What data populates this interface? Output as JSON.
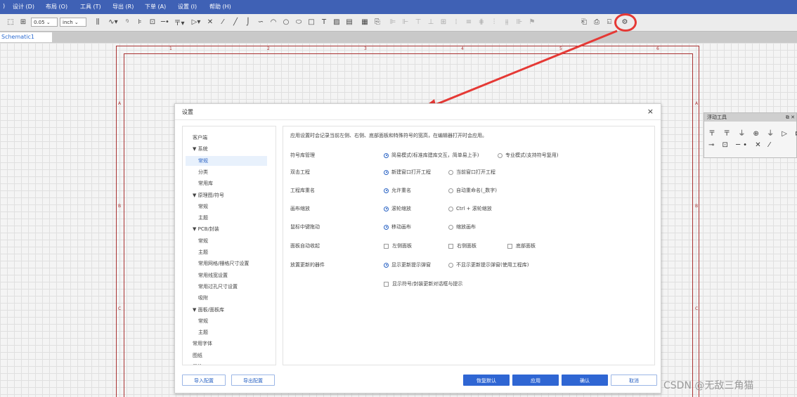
{
  "menu": [
    "设计 (D)",
    "布局 (O)",
    "工具 (T)",
    "导出 (R)",
    "下单 (A)",
    "设置 (I)",
    "帮助 (H)"
  ],
  "toolbar": {
    "grid_value": "0.05",
    "unit": "inch"
  },
  "tab": "Schematic1",
  "sheet": {
    "col_labels": [
      "1",
      "2",
      "3",
      "4",
      "5",
      "6"
    ],
    "row_labels": [
      "A",
      "B",
      "C"
    ]
  },
  "float_panel": {
    "title": "浮动工具",
    "row1": "〒 〒 ⏚ ⊕ ⏚ ▷ ⊳",
    "row2": "⊸ ⊡ ─• ✕ ⁄"
  },
  "dialog": {
    "title": "设置",
    "close": "×",
    "tree": [
      {
        "label": "客户端",
        "level": 0,
        "selected": false
      },
      {
        "label": "▼ 系统",
        "level": 0,
        "selected": false
      },
      {
        "label": "常规",
        "level": 1,
        "selected": true
      },
      {
        "label": "分类",
        "level": 1,
        "selected": false
      },
      {
        "label": "常用库",
        "level": 1,
        "selected": false
      },
      {
        "label": "▼ 原理图/符号",
        "level": 0,
        "selected": false
      },
      {
        "label": "常规",
        "level": 1,
        "selected": false
      },
      {
        "label": "主题",
        "level": 1,
        "selected": false
      },
      {
        "label": "▼ PCB/封装",
        "level": 0,
        "selected": false
      },
      {
        "label": "常规",
        "level": 1,
        "selected": false
      },
      {
        "label": "主题",
        "level": 1,
        "selected": false
      },
      {
        "label": "常用网格/栅格尺寸设置",
        "level": 1,
        "selected": false
      },
      {
        "label": "常用线宽设置",
        "level": 1,
        "selected": false
      },
      {
        "label": "常用过孔尺寸设置",
        "level": 1,
        "selected": false
      },
      {
        "label": "吸附",
        "level": 1,
        "selected": false
      },
      {
        "label": "▼ 面板/面板库",
        "level": 0,
        "selected": false
      },
      {
        "label": "常规",
        "level": 1,
        "selected": false
      },
      {
        "label": "主题",
        "level": 1,
        "selected": false
      },
      {
        "label": "常用字体",
        "level": 0,
        "selected": false
      },
      {
        "label": "图纸",
        "level": 0,
        "selected": false
      },
      {
        "label": "属性",
        "level": 0,
        "selected": false
      }
    ],
    "description": "应用设置时会记录当前左侧、右侧、底部面板和特殊符号的宽高，在编辑器打开时会应用。",
    "rows": [
      {
        "label": "符号库管理",
        "options": [
          {
            "type": "radio",
            "checked": true,
            "text": "简易模式(标准库建库交互，简单易上手)"
          },
          {
            "type": "radio",
            "checked": false,
            "text": "专业模式(支持符号复用)"
          }
        ]
      },
      {
        "label": "双击工程",
        "options": [
          {
            "type": "radio",
            "checked": true,
            "text": "新建窗口打开工程"
          },
          {
            "type": "radio",
            "checked": false,
            "text": "当前窗口打开工程"
          }
        ]
      },
      {
        "label": "工程库重名",
        "options": [
          {
            "type": "radio",
            "checked": true,
            "text": "允许重名"
          },
          {
            "type": "radio",
            "checked": false,
            "text": "自动重命名(_数字)"
          }
        ]
      },
      {
        "label": "画布缩放",
        "options": [
          {
            "type": "radio",
            "checked": true,
            "text": "滚轮缩放"
          },
          {
            "type": "radio",
            "checked": false,
            "text": "Ctrl + 滚轮缩放"
          }
        ]
      },
      {
        "label": "鼠标中键拖动",
        "options": [
          {
            "type": "radio",
            "checked": true,
            "text": "移动画布"
          },
          {
            "type": "radio",
            "checked": false,
            "text": "缩放画布"
          }
        ]
      },
      {
        "label": "面板自动收起",
        "options": [
          {
            "type": "check",
            "checked": false,
            "text": "左侧面板"
          },
          {
            "type": "check",
            "checked": false,
            "text": "右侧面板"
          },
          {
            "type": "check",
            "checked": false,
            "text": "底部面板"
          }
        ]
      },
      {
        "label": "放置更新的器件",
        "options": [
          {
            "type": "radio",
            "checked": true,
            "text": "显示更新提示弹窗"
          },
          {
            "type": "radio",
            "checked": false,
            "text": "不显示更新提示弹窗(使用工程库)"
          }
        ]
      },
      {
        "label": "",
        "options": [
          {
            "type": "check",
            "checked": false,
            "text": "显示符号/封装更新对话框与提示"
          }
        ]
      }
    ],
    "buttons": {
      "import": "导入配置",
      "export": "导出配置",
      "restore": "恢复默认",
      "apply": "应用",
      "confirm": "确认",
      "cancel": "取消"
    }
  },
  "watermark": "CSDN @无敌三角猫",
  "colors": {
    "menubar": "#3f61b5",
    "accent": "#2f66d3",
    "highlight": "#e53935"
  }
}
